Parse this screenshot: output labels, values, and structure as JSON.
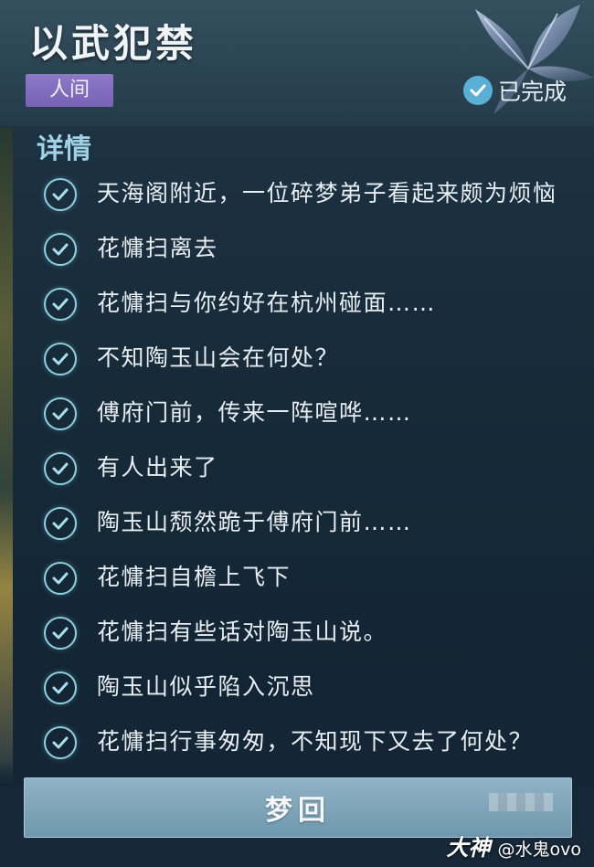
{
  "quest": {
    "title": "以武犯禁",
    "tag": "人间",
    "status_label": "已完成"
  },
  "details": {
    "heading": "详情",
    "steps": [
      {
        "text": "天海阁附近，一位碎梦弟子看起来颇为烦恼"
      },
      {
        "text": "花慵扫离去"
      },
      {
        "text": "花慵扫与你约好在杭州碰面……"
      },
      {
        "text": "不知陶玉山会在何处？"
      },
      {
        "text": "傅府门前，传来一阵喧哗……"
      },
      {
        "text": "有人出来了"
      },
      {
        "text": "陶玉山颓然跪于傅府门前……"
      },
      {
        "text": "花慵扫自檐上飞下"
      },
      {
        "text": "花慵扫有些话对陶玉山说。"
      },
      {
        "text": "陶玉山似乎陷入沉思"
      },
      {
        "text": "花慵扫行事匆匆，不知现下又去了何处？"
      }
    ]
  },
  "action": {
    "button_label": "梦回"
  },
  "watermark": {
    "logo": "大神",
    "user": "@水鬼ovo"
  },
  "colors": {
    "accent": "#8fd0e2",
    "tag_bg": "#7862b3",
    "button_bg": "#7fa4ba"
  }
}
